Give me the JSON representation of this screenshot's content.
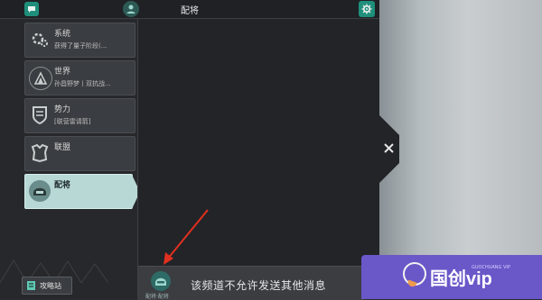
{
  "header": {
    "title": "配将"
  },
  "channels": [
    {
      "name": "系统",
      "subtitle": "获得了量子阶段(...",
      "icon": "gear-cog-icon"
    },
    {
      "name": "世界",
      "subtitle": "孙昌野梦丨双抗战...",
      "icon": "world-globe-icon"
    },
    {
      "name": "势力",
      "subtitle": "[联营雷请箭]",
      "icon": "faction-shield-icon"
    },
    {
      "name": "联盟",
      "subtitle": "",
      "icon": "alliance-armor-icon"
    },
    {
      "name": "配将",
      "subtitle": "",
      "icon": "general-helmet-icon"
    }
  ],
  "board_button": {
    "label": "攻略站"
  },
  "message_bar": {
    "text": "该频道不允许发送其他消息",
    "icon_label": "配将·配将"
  },
  "watermark": {
    "text": "国创vip",
    "small": "GUOCHUANG VIP"
  },
  "colors": {
    "accent": "#1f8f7b",
    "active_channel": "#b8d8d6",
    "watermark_bg": "#6a57c8",
    "arrow": "#e03020"
  }
}
